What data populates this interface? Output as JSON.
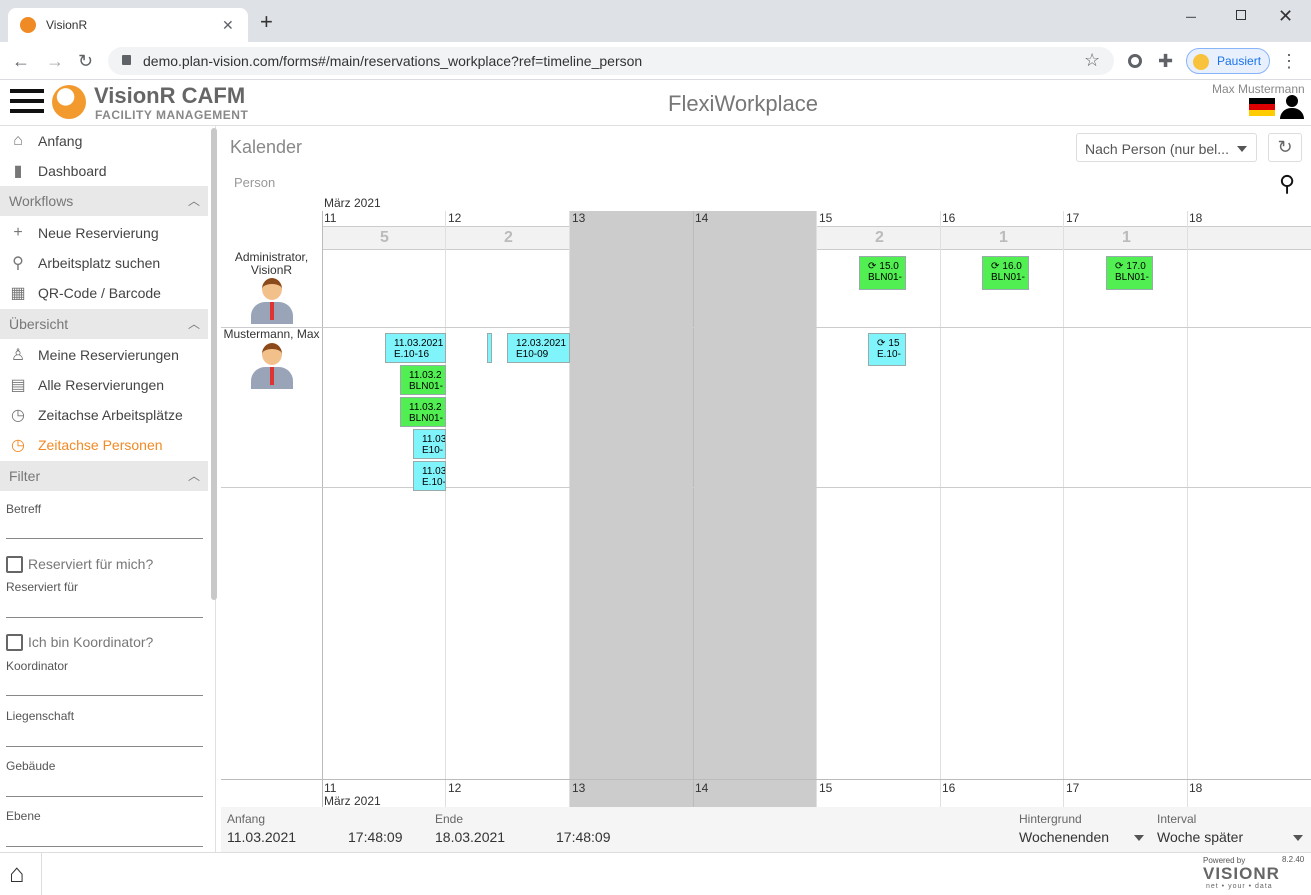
{
  "browser": {
    "tab_title": "VisionR",
    "url": "demo.plan-vision.com/forms#/main/reservations_workplace?ref=timeline_person",
    "paused_label": "Pausiert"
  },
  "header": {
    "brand_title": "VisionR CAFM",
    "brand_subtitle": "FACILITY MANAGEMENT",
    "page_title": "FlexiWorkplace",
    "user_name": "Max Mustermann"
  },
  "sidebar": {
    "top_items": [
      {
        "label": "Anfang",
        "icon": "home-icon"
      },
      {
        "label": "Dashboard",
        "icon": "bar-chart-icon"
      }
    ],
    "workflows": {
      "title": "Workflows",
      "items": [
        {
          "label": "Neue Reservierung",
          "icon": "plus-icon"
        },
        {
          "label": "Arbeitsplatz suchen",
          "icon": "search-icon"
        },
        {
          "label": "QR-Code / Barcode",
          "icon": "qr-code-icon"
        }
      ]
    },
    "overview": {
      "title": "Übersicht",
      "items": [
        {
          "label": "Meine Reservierungen",
          "icon": "person-icon"
        },
        {
          "label": "Alle Reservierungen",
          "icon": "calendar-icon"
        },
        {
          "label": "Zeitachse Arbeitsplätze",
          "icon": "clock-icon"
        },
        {
          "label": "Zeitachse Personen",
          "icon": "clock-icon",
          "active": true
        }
      ]
    },
    "filter": {
      "title": "Filter",
      "betreff": "Betreff",
      "reserved_for_me": "Reserviert für mich?",
      "reserved_for": "Reserviert für",
      "is_coordinator": "Ich bin Koordinator?",
      "coordinator": "Koordinator",
      "property": "Liegenschaft",
      "building": "Gebäude",
      "level": "Ebene"
    }
  },
  "calendar": {
    "title": "Kalender",
    "view_select": "Nach Person (nur bel...",
    "person_header": "Person",
    "month_label": "März 2021",
    "days": [
      "11",
      "12",
      "13",
      "14",
      "15",
      "16",
      "17",
      "18"
    ],
    "counts": [
      "5",
      "2",
      "",
      "",
      "2",
      "1",
      "1",
      ""
    ],
    "persons": [
      {
        "name": "Administrator,\nVisionR"
      },
      {
        "name": "Mustermann, Max"
      }
    ],
    "events": [
      {
        "line1": "15.0",
        "line2": "BLN01-",
        "sync": true
      },
      {
        "line1": "16.0",
        "line2": "BLN01-",
        "sync": true
      },
      {
        "line1": "17.0",
        "line2": "BLN01-",
        "sync": true
      },
      {
        "line1": "11.03.2021",
        "line2": "E.10-16"
      },
      {
        "line1": "12.03.2021",
        "line2": "E10-09"
      },
      {
        "line1": "15",
        "line2": "E.10-",
        "sync": true
      },
      {
        "line1": "11.03.2",
        "line2": "BLN01-"
      },
      {
        "line1": "11.03.2",
        "line2": "BLN01-"
      },
      {
        "line1": "11.03",
        "line2": "E10-"
      },
      {
        "line1": "11.03",
        "line2": "E.10-"
      }
    ],
    "colors": {
      "cyan": "#80f4fb",
      "green": "#52ef52",
      "weekend": "#cccccc"
    }
  },
  "footer": {
    "start_label": "Anfang",
    "start_date": "11.03.2021",
    "start_time": "17:48:09",
    "end_label": "Ende",
    "end_date": "18.03.2021",
    "end_time": "17:48:09",
    "background_label": "Hintergrund",
    "background_value": "Wochenenden",
    "interval_label": "Interval",
    "interval_value": "Woche später"
  },
  "bottom": {
    "powered_by": "Powered by",
    "version": "8.2.40",
    "brand": "VISIONR",
    "tagline": "net • your • data"
  }
}
